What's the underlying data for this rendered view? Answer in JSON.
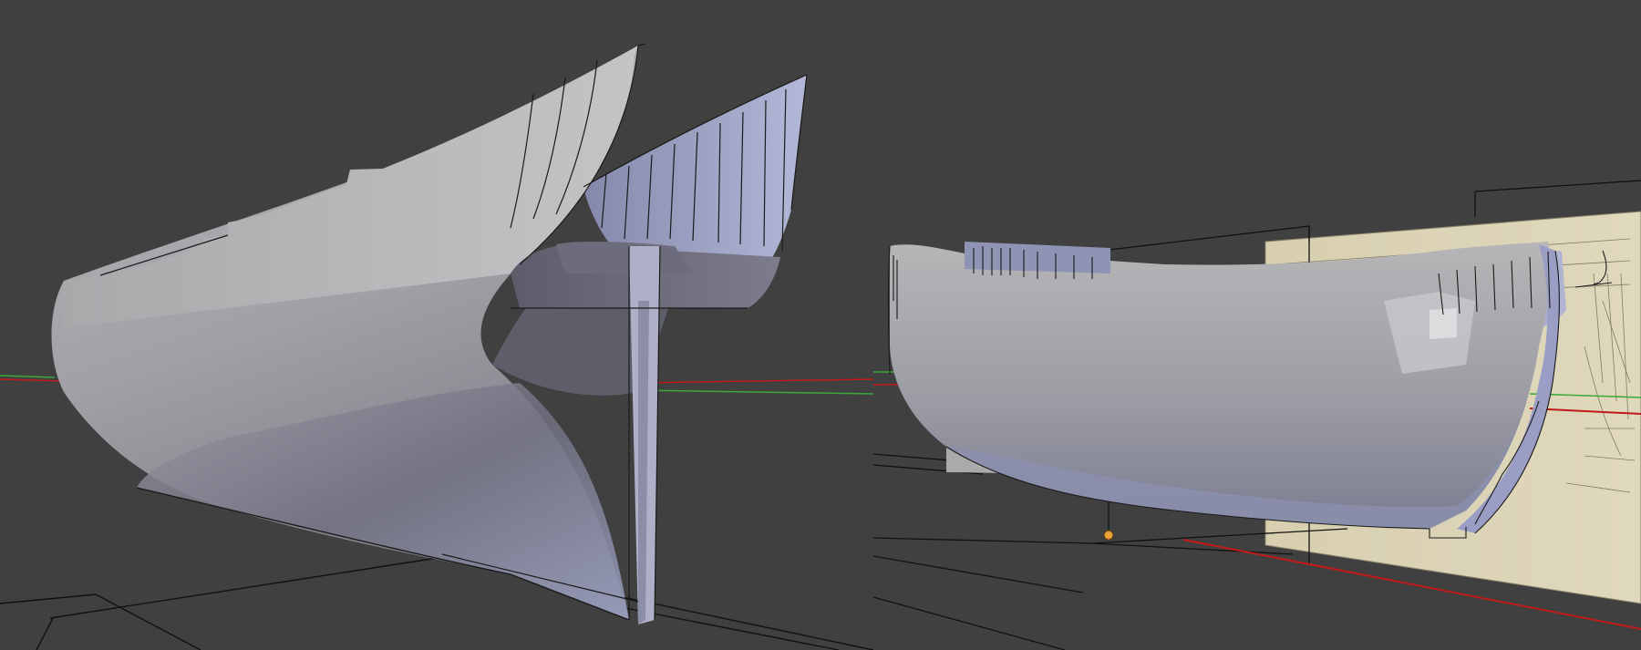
{
  "colors": {
    "background": "#404040",
    "hull_light": "#b0b0b4",
    "hull_shadow": "#6a6a78",
    "hull_blue": "#9a9ec4",
    "axis_x": "#c21a1a",
    "axis_y": "#3aa83a",
    "wire": "#0f0f0f",
    "blueprint_paper": "#ddd4b6",
    "object_origin": "#e8a23a"
  },
  "viewports": [
    {
      "id": "left",
      "view": "3d-perspective",
      "object": "ship-hull-stern",
      "show_floor_grid": true,
      "show_axes": true
    },
    {
      "id": "right",
      "view": "3d-perspective",
      "object": "ship-hull-side",
      "show_reference_image": true,
      "show_floor_grid": true,
      "show_axes": true
    }
  ]
}
